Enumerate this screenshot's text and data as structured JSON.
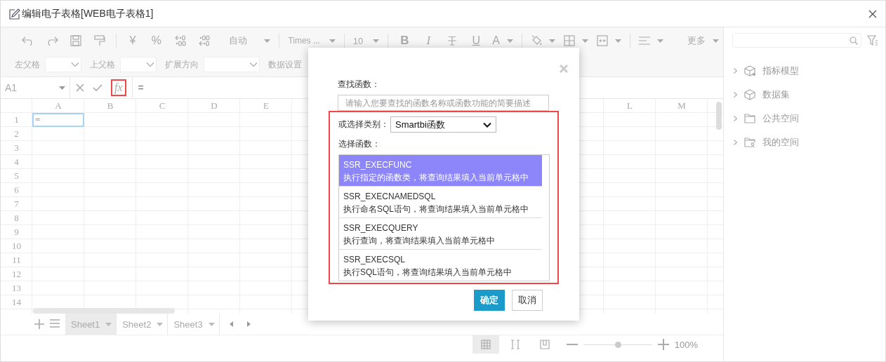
{
  "window": {
    "title": "编辑电子表格[WEB电子表格1]"
  },
  "toolbar": {
    "currency": "¥",
    "percent": "%",
    "number_format": "自动",
    "font_name": "Times ...",
    "font_size": "10",
    "bold": "B",
    "italic": "I",
    "underline": "U",
    "font_color": "A",
    "more": "更多"
  },
  "properties": [
    {
      "label": "左父格",
      "kind": "select"
    },
    {
      "label": "上父格",
      "kind": "select"
    },
    {
      "label": "扩展方向",
      "kind": "select"
    },
    {
      "label": "数据设置",
      "kind": "label"
    }
  ],
  "formula_bar": {
    "cell_ref": "A1",
    "fx": "fx",
    "fx_highlighted": true,
    "formula": "="
  },
  "sheet": {
    "columns": [
      "A",
      "B",
      "C",
      "D",
      "E",
      "L",
      "M"
    ],
    "rows": [
      "1",
      "2",
      "3",
      "4",
      "5",
      "6",
      "7",
      "8",
      "9",
      "10",
      "11",
      "12",
      "13",
      "14"
    ],
    "active_cell": {
      "value": "="
    }
  },
  "sheet_tabs": [
    {
      "label": "Sheet1",
      "selected": true
    },
    {
      "label": "Sheet2",
      "selected": false
    },
    {
      "label": "Sheet3",
      "selected": false
    }
  ],
  "status_bar": {
    "views": [
      {
        "selected": true
      },
      {
        "selected": false
      },
      {
        "selected": false
      }
    ],
    "zoom": {
      "level": 0.5,
      "reading": "100%"
    }
  },
  "side_panel": {
    "tree": [
      {
        "label": "指标模型",
        "kind": "model"
      },
      {
        "label": "数据集",
        "kind": "dataset"
      },
      {
        "label": "公共空间",
        "kind": "folder"
      },
      {
        "label": "我的空间",
        "kind": "user_folder"
      }
    ]
  },
  "dialog": {
    "search_label": "查找函数：",
    "search": {
      "placeholder": "请输入您要查找的函数名称或函数功能的简要描述"
    },
    "highlighted": true,
    "category_label": "或选择类别：",
    "category": {
      "value": "Smartbi函数"
    },
    "function_label": "选择函数：",
    "functions": [
      {
        "name": "SSR_EXECFUNC",
        "description": "执行指定的函数类，将查询结果填入当前单元格中",
        "selected": true
      },
      {
        "name": "SSR_EXECNAMEDSQL",
        "description": "执行命名SQL语句，将查询结果填入当前单元格中",
        "selected": false
      },
      {
        "name": "SSR_EXECQUERY",
        "description": "执行查询，将查询结果填入当前单元格中",
        "selected": false
      },
      {
        "name": "SSR_EXECSQL",
        "description": "执行SQL语句，将查询结果填入当前单元格中",
        "selected": false
      }
    ],
    "buttons": [
      {
        "label": "确定",
        "kind": "primary"
      },
      {
        "label": "取消",
        "kind": "secondary"
      }
    ]
  }
}
